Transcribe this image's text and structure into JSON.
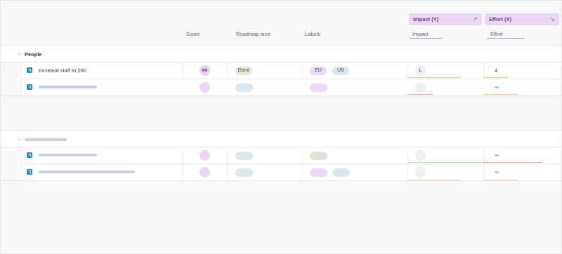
{
  "header": {
    "columns": {
      "score": "Score",
      "roadmap_lane": "Roadmap lane",
      "labels": "Labels"
    },
    "impact_pill": {
      "label": "Impact (Y)",
      "arrow": "↗"
    },
    "effort_pill": {
      "label": "Effort (X)",
      "arrow": "↘"
    },
    "impact_sub": "Impact",
    "effort_sub": "Effort"
  },
  "groups": [
    {
      "title": "People",
      "rows": [
        {
          "title": "Increase staff to 200",
          "score": "64",
          "lane": "Done",
          "labels": [
            "EU",
            "US"
          ],
          "impact": "L",
          "effort": "4"
        },
        {
          "title": "",
          "score": "",
          "lane": "",
          "labels": [],
          "impact": "",
          "effort": ""
        }
      ]
    },
    {
      "title": "",
      "rows": [
        {
          "title": "",
          "score": "",
          "lane": "",
          "labels": [],
          "impact": "",
          "effort": ""
        },
        {
          "title": "",
          "score": "",
          "lane": "",
          "labels": [],
          "impact": "",
          "effort": ""
        }
      ]
    }
  ],
  "colors": {
    "accent_purple": "#ead7f4",
    "impact_bar_red": "#f0a8a0",
    "impact_bar_orange": "#f3c48f",
    "impact_bar_green": "#bfe0b8",
    "jira_blue": "#2d86e6"
  },
  "icons": {
    "chevron": "chevron-down-icon",
    "issue": "jira-story-icon",
    "trend_up": "trend-up-icon",
    "trend_down": "trend-down-icon"
  }
}
